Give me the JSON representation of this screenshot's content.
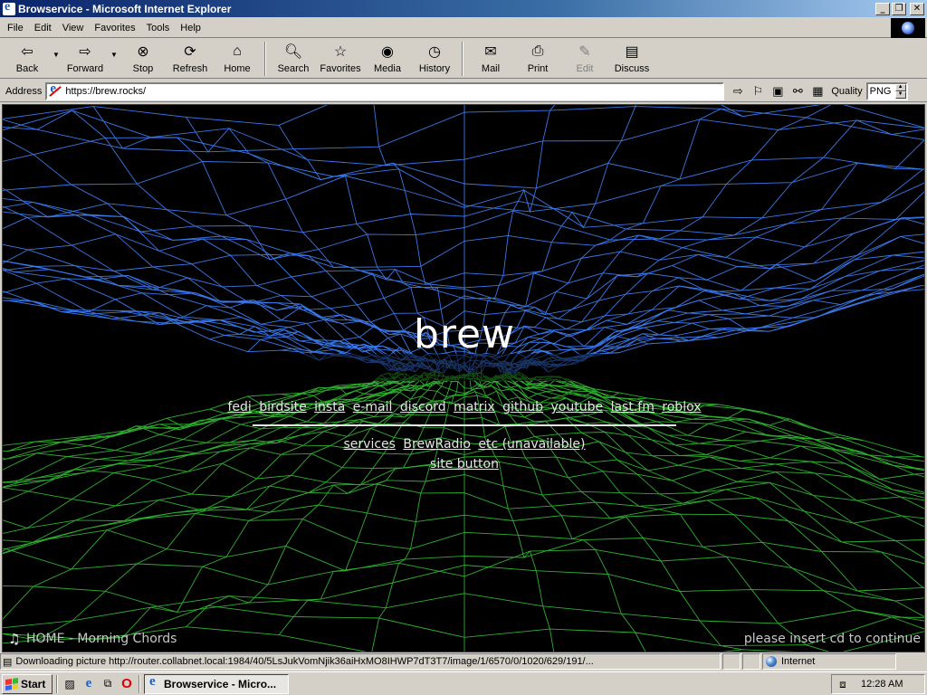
{
  "window": {
    "title": "Browservice - Microsoft Internet Explorer"
  },
  "menu": [
    "File",
    "Edit",
    "View",
    "Favorites",
    "Tools",
    "Help"
  ],
  "toolbar": {
    "back": "Back",
    "forward": "Forward",
    "stop": "Stop",
    "refresh": "Refresh",
    "home": "Home",
    "search": "Search",
    "favorites": "Favorites",
    "media": "Media",
    "history": "History",
    "mail": "Mail",
    "print": "Print",
    "edit": "Edit",
    "discuss": "Discuss"
  },
  "address": {
    "label": "Address",
    "url": "https://brew.rocks/",
    "quality_label": "Quality",
    "quality_value": "PNG"
  },
  "page": {
    "title": "brew",
    "links1": [
      "fedi",
      "birdsite",
      "insta",
      "e-mail",
      "discord",
      "matrix",
      "github",
      "youtube",
      "last.fm",
      "roblox"
    ],
    "links2": [
      "services",
      "BrewRadio",
      "etc (unavailable)"
    ],
    "links3": [
      "site button"
    ],
    "now_playing": "HOME - Morning Chords",
    "insert_cd": "please insert cd to continue",
    "colors": {
      "upper_mesh": "#3a78e8",
      "lower_mesh": "#2fae2f"
    }
  },
  "status": {
    "text": "Downloading picture http://router.collabnet.local:1984/40/5LsJukVomNjik36aiHxMO8IHWP7dT3T7/image/1/6570/0/1020/629/191/...",
    "zone": "Internet"
  },
  "taskbar": {
    "start": "Start",
    "task": "Browservice - Micro...",
    "clock": "12:28 AM"
  }
}
